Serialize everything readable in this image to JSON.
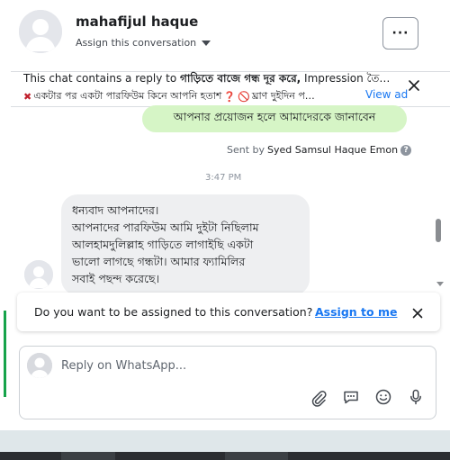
{
  "header": {
    "contact_name": "mahafijul haque",
    "assign_label": "Assign this conversation",
    "more_label": "···"
  },
  "context": {
    "prefix": "This chat contains a reply to ",
    "ad_title": "গাড়িতে বাজে গন্ধ দূর করে,",
    "suffix": " Impression তৈ…",
    "cross": "✖",
    "ad_text": " একটার পর একটা পারফিউম কিনে আপনি হতাশ",
    "question_mark": "❓",
    "no_symbol": "🚫",
    "ad_text2": " ঘ্রাণ দুইদিন প…",
    "view_ad": "View ad"
  },
  "messages": {
    "outgoing_text": "আপনার প্রয়োজন হলে আমাদেরকে জানাবেন",
    "sent_by_prefix": "Sent by ",
    "sent_by_name": "Syed Samsul Haque Emon",
    "info_glyph": "?",
    "timestamp": "3:47 PM",
    "incoming_lines": [
      "ধন্যবাদ আপনাদের।",
      "আপনাদের পারফিউম আমি দুইটা নিছিলাম",
      "আলহামদুলিল্লাহ গাড়িতে লাগাইছি একটা",
      "ভালো লাগছে গন্ধটা। আমার ফ্যামিলির",
      "সবাই পছন্দ করেছে।"
    ]
  },
  "assign_prompt": {
    "question": "Do you want to be assigned to this conversation?",
    "action": "Assign to me"
  },
  "composer": {
    "placeholder": "Reply on WhatsApp...",
    "value": ""
  },
  "icons": {
    "attach": "paperclip-icon",
    "comment": "comment-icon",
    "emoji": "emoji-icon",
    "mic": "microphone-icon",
    "close": "close-icon"
  },
  "colors": {
    "outgoing_bubble": "#d6f5c6",
    "incoming_bubble": "#eeeff1",
    "link": "#1877f2",
    "accent": "#16a34a"
  }
}
